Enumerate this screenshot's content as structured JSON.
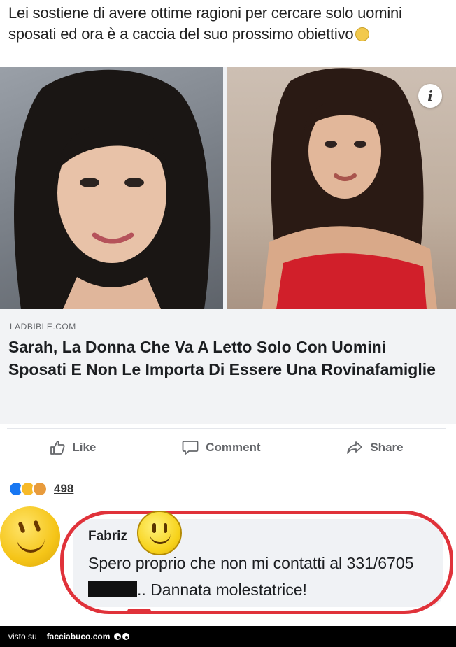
{
  "post": {
    "text": "Lei sostiene di avere ottime ragioni per cercare solo uomini sposati ed ora è a caccia del suo prossimo obiettivo",
    "emoji": "grin-sweat-emoji"
  },
  "link_preview": {
    "domain": "LADBIBLE.COM",
    "title": "Sarah, La Donna Che Va A Letto Solo Con Uomini Sposati E Non Le Importa Di Essere Una Rovinafamiglie",
    "info_label": "i"
  },
  "actions": {
    "like": "Like",
    "comment": "Comment",
    "share": "Share"
  },
  "reactions": {
    "count": "498",
    "types": [
      "like",
      "haha",
      "wow"
    ]
  },
  "comment": {
    "author": "Fabriz",
    "text_before": "Spero proprio che non mi contatti al 331/6705",
    "text_after": ".. Dannata molestatrice!"
  },
  "footer": {
    "prefix": "visto su",
    "site": "facciabuco.com"
  },
  "colors": {
    "highlight_ring": "#e0323a",
    "like_blue": "#1877f2"
  }
}
